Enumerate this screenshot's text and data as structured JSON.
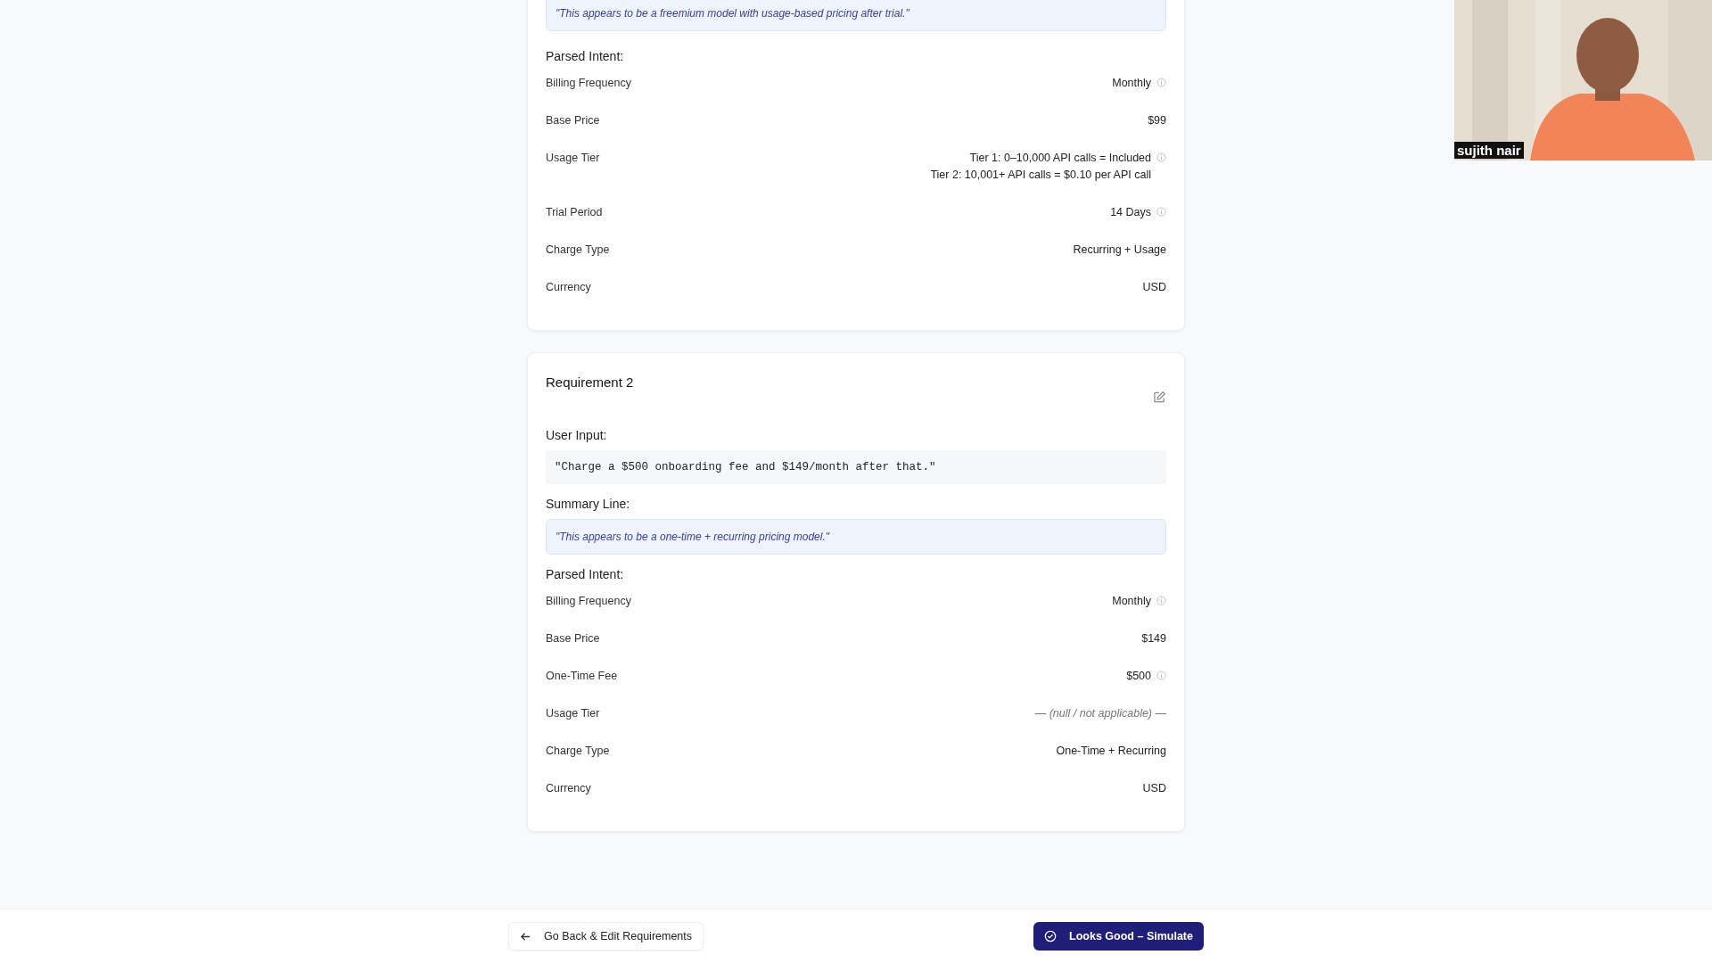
{
  "cards": [
    {
      "summary": "\"This appears to be a freemium model with usage-based pricing after trial.\"",
      "parsed_label": "Parsed Intent:",
      "rows": [
        {
          "label": "Billing Frequency",
          "kind": "text",
          "lines": [
            "Monthly"
          ],
          "info": true
        },
        {
          "label": "Base Price",
          "kind": "text",
          "lines": [
            "$99"
          ],
          "info": false
        },
        {
          "label": "Usage Tier",
          "kind": "text",
          "lines": [
            "Tier 1: 0–10,000 API calls = Included",
            "Tier 2: 10,001+ API calls = $0.10 per API call"
          ],
          "info": true
        },
        {
          "label": "Trial Period",
          "kind": "text",
          "lines": [
            "14 Days"
          ],
          "info": true
        },
        {
          "label": "Charge Type",
          "kind": "text",
          "lines": [
            "Recurring + Usage"
          ],
          "info": false
        },
        {
          "label": "Currency",
          "kind": "text",
          "lines": [
            "USD"
          ],
          "info": false
        }
      ]
    },
    {
      "title": "Requirement 2",
      "input_label": "User Input:",
      "input": "\"Charge a $500 onboarding fee and $149/month after that.\"",
      "summary_label": "Summary Line:",
      "summary": "\"This appears to be a one-time + recurring pricing model.\"",
      "parsed_label": "Parsed Intent:",
      "rows": [
        {
          "label": "Billing Frequency",
          "kind": "text",
          "lines": [
            "Monthly"
          ],
          "info": true
        },
        {
          "label": "Base Price",
          "kind": "text",
          "lines": [
            "$149"
          ],
          "info": false
        },
        {
          "label": "One-Time Fee",
          "kind": "text",
          "lines": [
            "$500"
          ],
          "info": true
        },
        {
          "label": "Usage Tier",
          "kind": "null",
          "lines": [
            "— (null / not applicable) —"
          ],
          "info": false
        },
        {
          "label": "Charge Type",
          "kind": "text",
          "lines": [
            "One-Time + Recurring"
          ],
          "info": false
        },
        {
          "label": "Currency",
          "kind": "text",
          "lines": [
            "USD"
          ],
          "info": false
        }
      ]
    }
  ],
  "footer": {
    "back": "Go Back & Edit Requirements",
    "next": "Looks Good – Simulate"
  },
  "video": {
    "name": "sujith nair"
  }
}
